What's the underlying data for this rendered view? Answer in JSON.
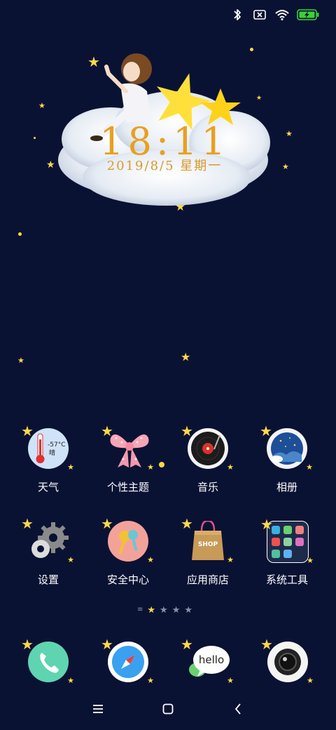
{
  "status_bar": {
    "icons": [
      "bluetooth-icon",
      "sim-none-icon",
      "wifi-icon",
      "battery-charging-icon"
    ],
    "accent": "#3ad13a"
  },
  "clock_widget": {
    "time": "18:11",
    "date": "2019/8/5 星期一"
  },
  "apps": [
    {
      "label": "天气",
      "icon": "weather-icon",
      "temp": "-57°C",
      "condition": "晴"
    },
    {
      "label": "个性主题",
      "icon": "theme-bow-icon"
    },
    {
      "label": "音乐",
      "icon": "music-record-icon"
    },
    {
      "label": "相册",
      "icon": "gallery-icon"
    },
    {
      "label": "设置",
      "icon": "settings-gear-icon"
    },
    {
      "label": "安全中心",
      "icon": "security-keys-icon"
    },
    {
      "label": "应用商店",
      "icon": "shop-bag-icon",
      "badge_text": "SHOP"
    },
    {
      "label": "系统工具",
      "icon": "system-tools-icon"
    }
  ],
  "page_indicator": {
    "pages": 4,
    "current": 1
  },
  "dock": [
    {
      "name": "phone",
      "icon": "phone-icon"
    },
    {
      "name": "browser",
      "icon": "compass-icon"
    },
    {
      "name": "messages",
      "icon": "chat-bubble-icon",
      "text": "hello"
    },
    {
      "name": "camera",
      "icon": "camera-icon"
    }
  ],
  "nav_bar": {
    "buttons": [
      "menu-icon",
      "home-icon",
      "back-icon"
    ]
  },
  "colors": {
    "background": "#0a1233",
    "star": "#ffd84a",
    "clock": "#e8a020"
  }
}
